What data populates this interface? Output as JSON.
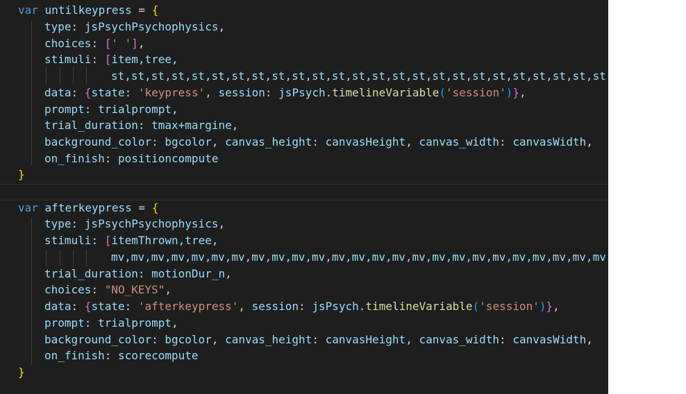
{
  "block1": {
    "decl_kw": "var",
    "decl_name": "untilkeypress",
    "decl_eq": " = ",
    "open": "{",
    "type_key": "type",
    "type_val": "jsPsychPsychophysics",
    "choices_key": "choices",
    "choices_open": "[",
    "choices_str": "' '",
    "choices_close": "]",
    "stimuli_key": "stimuli",
    "stimuli_open": "[",
    "stimuli_head": "item,tree,",
    "stimuli_cont": "st,st,st,st,st,st,st,st,st,st,st,st,st,st,st,st,st,st,st,st,st,st,st,st,st,",
    "data_key": "data",
    "data_open": "{",
    "data_state_key": "state",
    "data_state_val": "'keypress'",
    "data_session_key": "session",
    "data_obj": "jsPsych",
    "data_method": "timelineVariable",
    "data_paren_open": "(",
    "data_session_str": "'session'",
    "data_paren_close": ")",
    "data_close": "}",
    "prompt_key": "prompt",
    "prompt_val": "trialprompt",
    "duration_key": "trial_duration",
    "duration_val": "tmax+margine",
    "bg_key": "background_color",
    "bg_val": "bgcolor",
    "ch_key": "canvas_height",
    "ch_val": "canvasHeight",
    "cw_key": "canvas_width",
    "cw_val": "canvasWidth",
    "finish_key": "on_finish",
    "finish_val": "positioncompute",
    "close": "}"
  },
  "block2": {
    "decl_kw": "var",
    "decl_name": "afterkeypress",
    "decl_eq": " = ",
    "open": "{",
    "type_key": "type",
    "type_val": "jsPsychPsychophysics",
    "stimuli_key": "stimuli",
    "stimuli_open": "[",
    "stimuli_head": "itemThrown,tree,",
    "stimuli_cont": "mv,mv,mv,mv,mv,mv,mv,mv,mv,mv,mv,mv,mv,mv,mv,mv,mv,mv,mv,mv,mv,mv,mv,mv,mv,",
    "duration_key": "trial_duration",
    "duration_val": "motionDur_n",
    "choices_key": "choices",
    "choices_str": "\"NO_KEYS\"",
    "data_key": "data",
    "data_open": "{",
    "data_state_key": "state",
    "data_state_val": "'afterkeypress'",
    "data_session_key": "session",
    "data_obj": "jsPsych",
    "data_method": "timelineVariable",
    "data_paren_open": "(",
    "data_session_str": "'session'",
    "data_paren_close": ")",
    "data_close": "}",
    "prompt_key": "prompt",
    "prompt_val": "trialprompt",
    "bg_key": "background_color",
    "bg_val": "bgcolor",
    "ch_key": "canvas_height",
    "ch_val": "canvasHeight",
    "cw_key": "canvas_width",
    "cw_val": "canvasWidth",
    "finish_key": "on_finish",
    "finish_val": "scorecompute",
    "close": "}"
  }
}
